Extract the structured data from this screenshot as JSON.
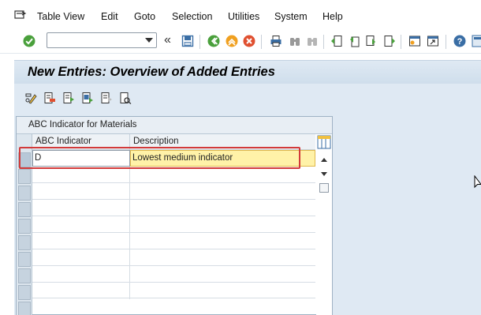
{
  "menu": [
    "Table View",
    "Edit",
    "Goto",
    "Selection",
    "Utilities",
    "System",
    "Help"
  ],
  "command_field": {
    "value": ""
  },
  "toolbar_icons": [
    "enter-icon",
    "collapse-icon",
    "save-icon",
    "back-icon",
    "exit-icon",
    "cancel-icon",
    "print-icon",
    "find-icon",
    "find-next-icon",
    "first-page-icon",
    "previous-page-icon",
    "next-page-icon",
    "last-page-icon",
    "create-session-icon",
    "shortcut-icon",
    "help-icon",
    "customize-layout-icon"
  ],
  "title": "New Entries: Overview of Added Entries",
  "app_toolbar_icons": [
    "change-display-icon",
    "delete-icon",
    "select-all-icon",
    "select-block-icon",
    "deselect-all-icon",
    "choose-icon"
  ],
  "table": {
    "panel_title": "ABC Indicator for Materials",
    "columns": [
      "ABC Indicator",
      "Description"
    ],
    "rows": [
      {
        "abc_indicator": "D",
        "description": "Lowest medium indicator"
      }
    ],
    "empty_rows": 9
  }
}
